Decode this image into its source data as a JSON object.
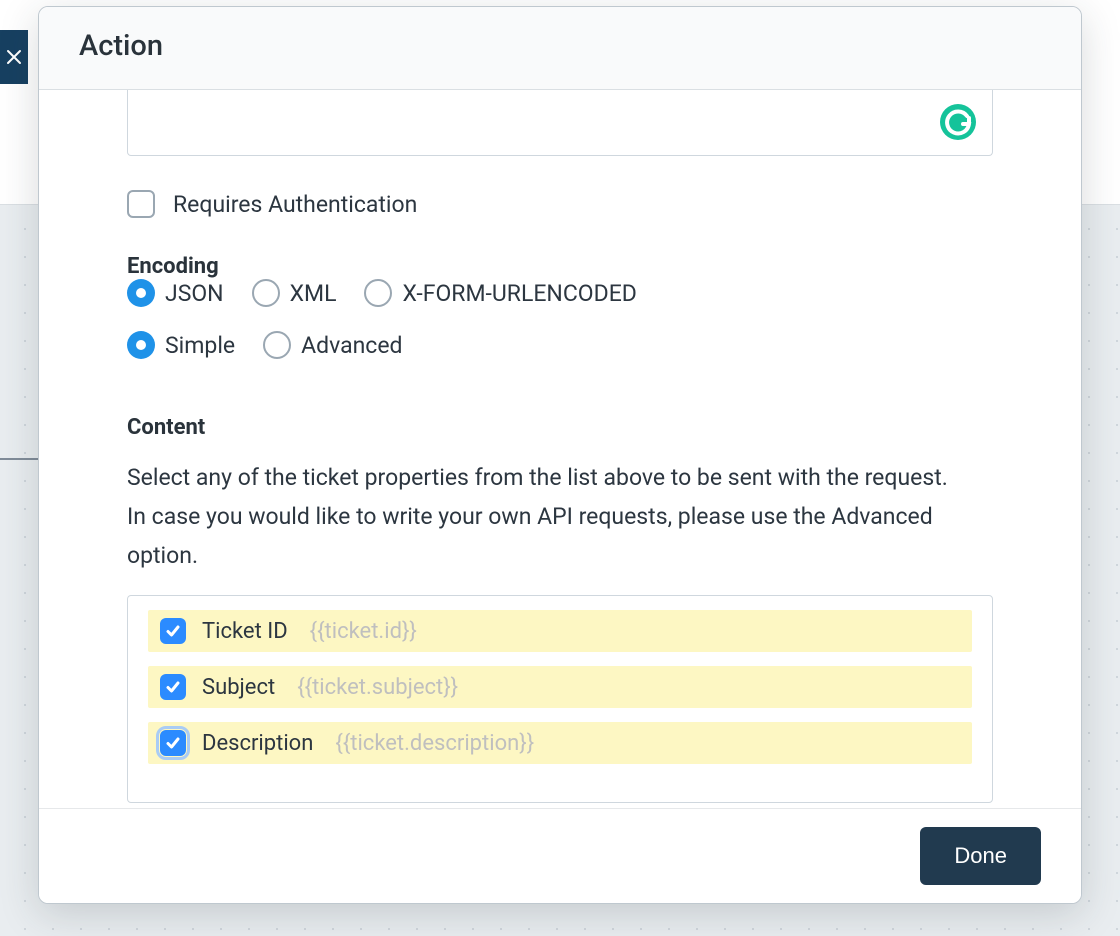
{
  "header": {
    "title": "Action"
  },
  "auth": {
    "requires_label": "Requires Authentication",
    "checked": false
  },
  "encoding": {
    "title": "Encoding",
    "json": "JSON",
    "json_selected": true,
    "xml": "XML",
    "xml_selected": false,
    "xform": "X-FORM-URLENCODED",
    "xform_selected": false,
    "simple": "Simple",
    "simple_selected": true,
    "advanced": "Advanced",
    "advanced_selected": false
  },
  "content": {
    "title": "Content",
    "help": "Select any of the ticket properties from the list above to be sent with the request. In case you would like to write your own API requests, please use the Advanced option.",
    "items": [
      {
        "name": "Ticket ID",
        "token": "{{ticket.id}}",
        "checked": true,
        "focused": false
      },
      {
        "name": "Subject",
        "token": "{{ticket.subject}}",
        "checked": true,
        "focused": false
      },
      {
        "name": "Description",
        "token": "{{ticket.description}}",
        "checked": true,
        "focused": true
      }
    ]
  },
  "footer": {
    "done": "Done"
  }
}
